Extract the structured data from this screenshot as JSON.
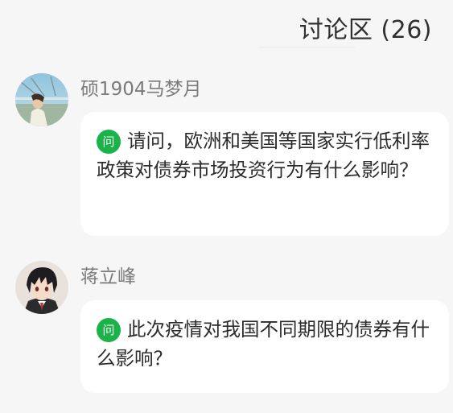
{
  "header": {
    "title": "讨论区 (26)"
  },
  "comments": [
    {
      "username": "硕1904马梦月",
      "badge": "问",
      "text": "请问，欧洲和美国等国家实行低利率政策对债券市场投资行为有什么影响？"
    },
    {
      "username": "蒋立峰",
      "badge": "问",
      "text": "此次疫情对我国不同期限的债券有什么影响？"
    }
  ],
  "colors": {
    "background": "#f6f6f7",
    "bubble": "#ffffff",
    "badge_green": "#19b34a",
    "username_gray": "#7b7b7b"
  }
}
